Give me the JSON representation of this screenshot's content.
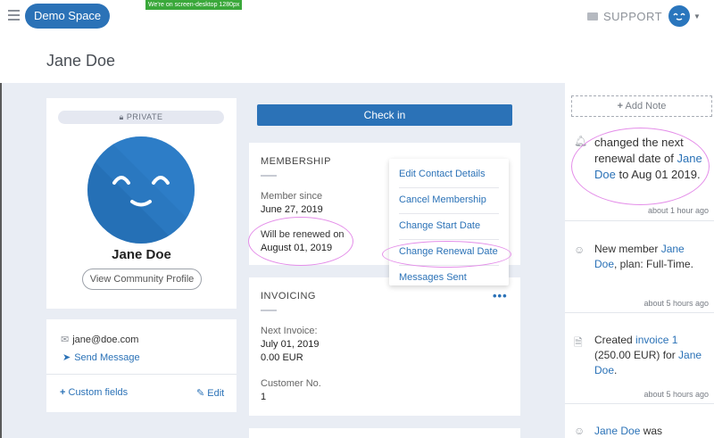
{
  "header": {
    "space_label": "Demo Space",
    "dev_badge": "We're on screen-desktop 1280px",
    "support_label": "SUPPORT"
  },
  "page": {
    "title": "Jane Doe"
  },
  "profile": {
    "private_label": "PRIVATE",
    "name": "Jane Doe",
    "view_profile_label": "View Community Profile"
  },
  "contact": {
    "email": "jane@doe.com",
    "send_message_label": "Send Message",
    "custom_fields_label": "Custom fields",
    "edit_label": "Edit"
  },
  "checkin_label": "Check in",
  "membership": {
    "title": "MEMBERSHIP",
    "member_since_label": "Member since",
    "member_since_value": "June 27, 2019",
    "renewal_label": "Will be renewed on",
    "renewal_value": "August 01, 2019"
  },
  "menu": {
    "items": [
      "Edit Contact Details",
      "Cancel Membership",
      "Change Start Date",
      "Change Renewal Date",
      "Messages Sent"
    ]
  },
  "invoicing": {
    "title": "INVOICING",
    "next_invoice_label": "Next Invoice:",
    "next_invoice_date": "July 01, 2019",
    "next_invoice_amount": "0.00 EUR",
    "customer_no_label": "Customer No.",
    "customer_no_value": "1"
  },
  "activity": {
    "add_note_label": "Add Note",
    "items": [
      {
        "pre": "changed the next renewal date of",
        "link": "Jane Doe",
        "post": "to Aug 01 2019.",
        "time": "about 1 hour ago"
      },
      {
        "pre": "New member",
        "link": "Jane Doe",
        "post": ", plan: Full-Time.",
        "time": "about 5 hours ago"
      },
      {
        "pre": "Created",
        "link": "invoice 1",
        "mid": "(250.00 EUR) for",
        "link2": "Jane Doe",
        "post": ".",
        "time": "about 5 hours ago"
      },
      {
        "link": "Jane Doe",
        "post": "was"
      }
    ]
  },
  "colors": {
    "accent": "#2b72b7",
    "highlight_ring": "#e48ee9",
    "background": "#e9edf4"
  }
}
